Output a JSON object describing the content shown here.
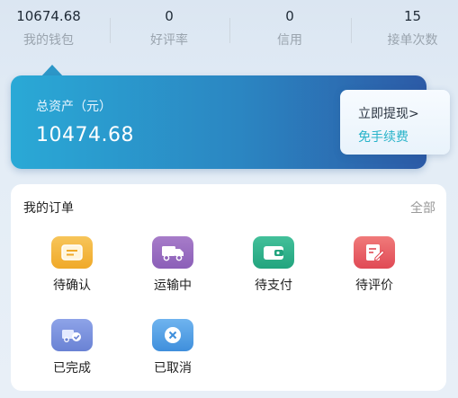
{
  "stats": [
    {
      "value": "10674.68",
      "label": "我的钱包"
    },
    {
      "value": "0",
      "label": "好评率"
    },
    {
      "value": "0",
      "label": "信用"
    },
    {
      "value": "15",
      "label": "接单次数"
    }
  ],
  "asset": {
    "title": "总资产（元）",
    "amount": "10474.68",
    "withdraw_label": "立即提现>",
    "fee_free_label": "免手续费"
  },
  "orders": {
    "title": "我的订单",
    "all_label": "全部",
    "items": [
      {
        "label": "待确认",
        "icon": "pending-confirm-icon",
        "color": "#f3b53a"
      },
      {
        "label": "运输中",
        "icon": "truck-icon",
        "color": "#9a6fc2"
      },
      {
        "label": "待支付",
        "icon": "wallet-icon",
        "color": "#2fb28b"
      },
      {
        "label": "待评价",
        "icon": "review-edit-icon",
        "color": "#e85f66"
      },
      {
        "label": "已完成",
        "icon": "completed-delivery-icon",
        "color": "#7b92de"
      },
      {
        "label": "已取消",
        "icon": "cancel-icon",
        "color": "#5aa3e8"
      }
    ]
  }
}
